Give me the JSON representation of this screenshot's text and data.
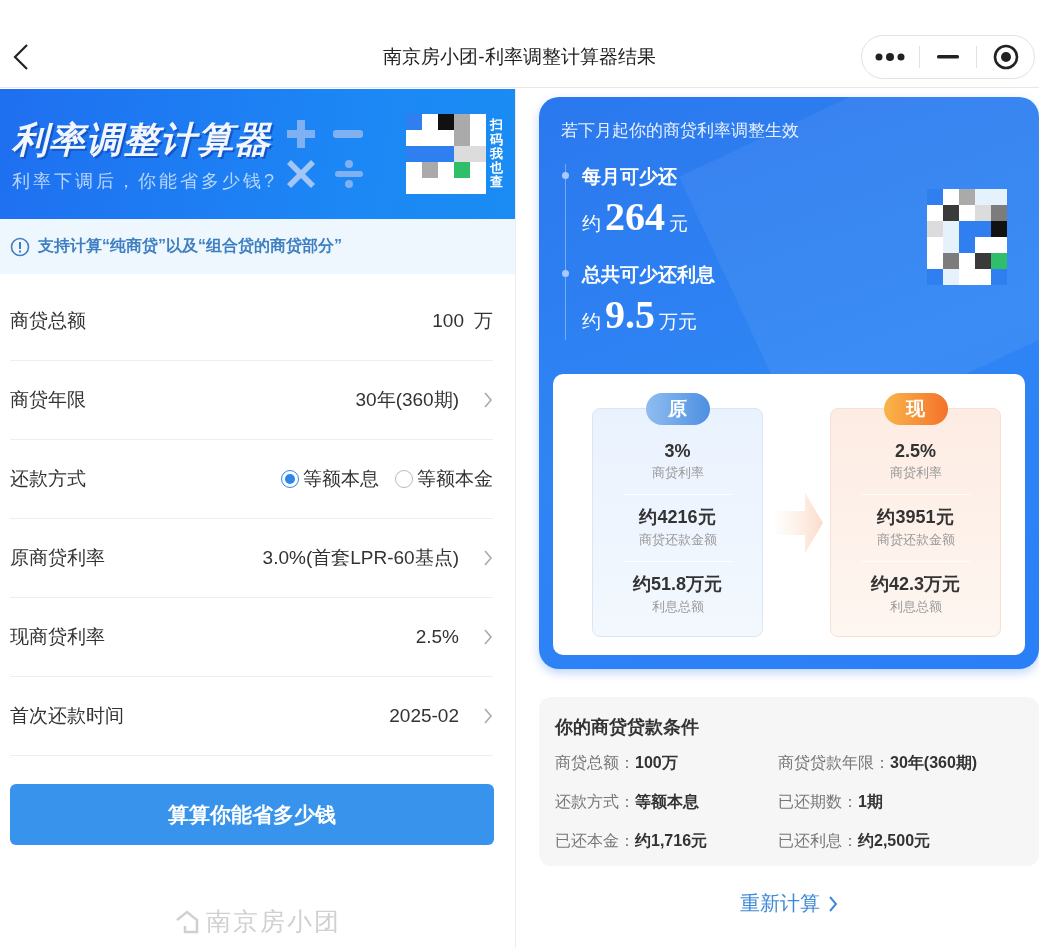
{
  "header": {
    "title": "南京房小团-利率调整计算器结果"
  },
  "banner": {
    "title": "利率调整计算器",
    "subtitle": "利率下调后，你能省多少钱?",
    "qr_caption": "扫码我也查"
  },
  "notice": {
    "text": "支持计算“纯商贷”以及“组合贷的商贷部分”"
  },
  "form": {
    "rows": [
      {
        "kind": "input",
        "label": "商贷总额",
        "value": "100",
        "unit": "万"
      },
      {
        "kind": "select",
        "label": "商贷年限",
        "value": "30年(360期)"
      },
      {
        "kind": "radio",
        "label": "还款方式",
        "options": [
          {
            "label": "等额本息",
            "selected": true
          },
          {
            "label": "等额本金",
            "selected": false
          }
        ]
      },
      {
        "kind": "select",
        "label": "原商贷利率",
        "value": "3.0%(首套LPR-60基点)"
      },
      {
        "kind": "select",
        "label": "现商贷利率",
        "value": "2.5%"
      },
      {
        "kind": "select",
        "label": "首次还款时间",
        "value": "2025-02"
      }
    ],
    "submit": "算算你能省多少钱"
  },
  "footer": {
    "brand": "南京房小团"
  },
  "result": {
    "heading": "若下月起你的商贷利率调整生效",
    "savings": [
      {
        "label": "每月可少还",
        "prefix": "约",
        "amount": "264",
        "unit": "元"
      },
      {
        "label": "总共可少还利息",
        "prefix": "约",
        "amount": "9.5",
        "unit": "万元"
      }
    ],
    "compare": [
      {
        "badge": "原",
        "kind": "before",
        "stats": [
          {
            "value": "3%",
            "label": "商贷利率"
          },
          {
            "value": "约4216元",
            "label": "商贷还款金额"
          },
          {
            "value": "约51.8万元",
            "label": "利息总额"
          }
        ]
      },
      {
        "badge": "现",
        "kind": "after",
        "stats": [
          {
            "value": "2.5%",
            "label": "商贷利率"
          },
          {
            "value": "约3951元",
            "label": "商贷还款金额"
          },
          {
            "value": "约42.3万元",
            "label": "利息总额"
          }
        ]
      }
    ]
  },
  "conditions": {
    "title": "你的商贷贷款条件",
    "items": [
      {
        "label": "商贷总额：",
        "value": "100万"
      },
      {
        "label": "商贷贷款年限：",
        "value": "30年(360期)"
      },
      {
        "label": "还款方式：",
        "value": "等额本息"
      },
      {
        "label": "已还期数：",
        "value": "1期"
      },
      {
        "label": "已还本金：",
        "value": "约1,716元"
      },
      {
        "label": "已还利息：",
        "value": "约2,500元"
      }
    ]
  },
  "recalc": {
    "label": "重新计算"
  }
}
